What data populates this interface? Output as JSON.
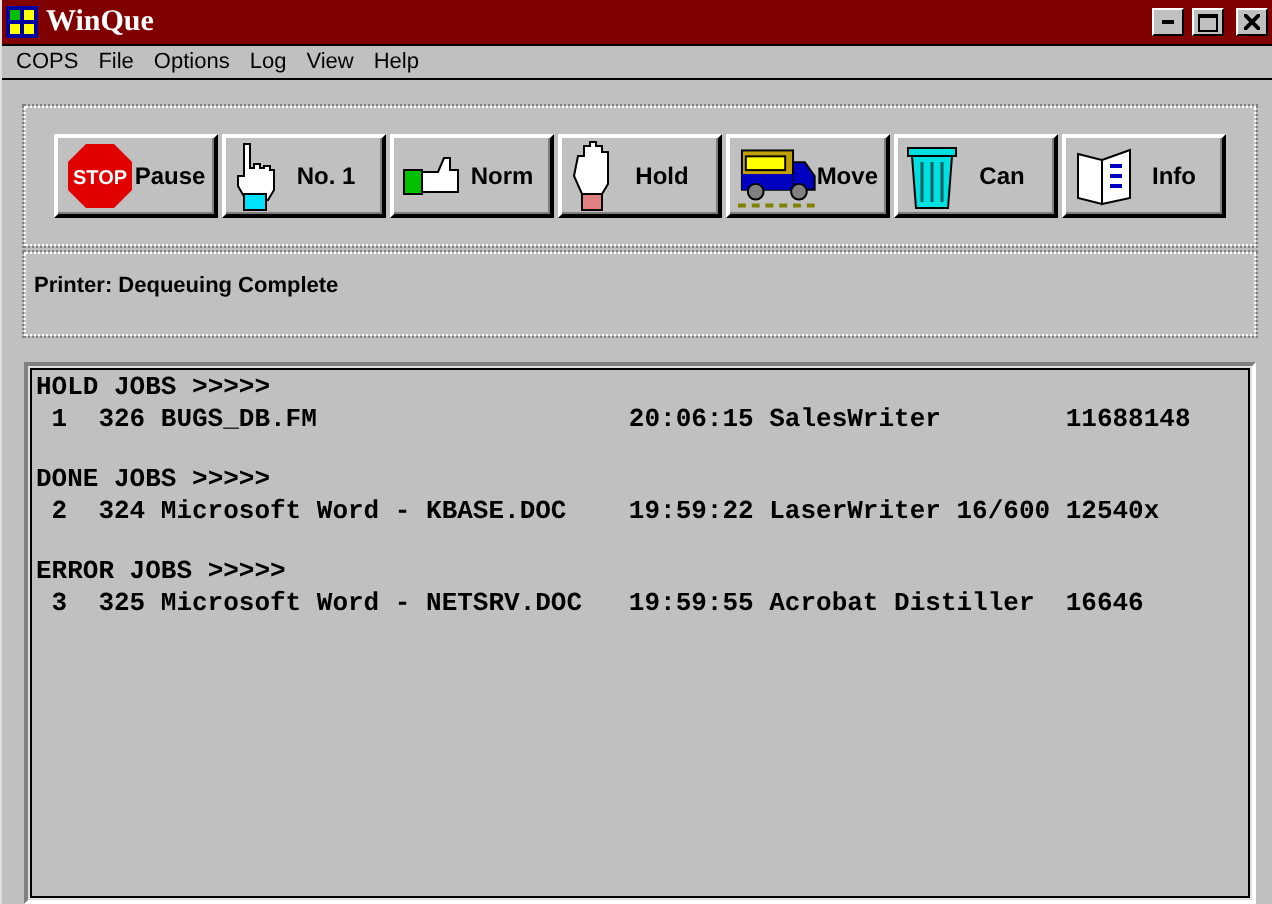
{
  "window": {
    "title": "WinQue"
  },
  "menu": [
    "COPS",
    "File",
    "Options",
    "Log",
    "View",
    "Help"
  ],
  "toolbar": [
    {
      "kind": "stop",
      "label": "Pause",
      "icon_text": "STOP"
    },
    {
      "kind": "pointing",
      "label": "No. 1"
    },
    {
      "kind": "thumb",
      "label": "Norm"
    },
    {
      "kind": "hand",
      "label": "Hold"
    },
    {
      "kind": "van",
      "label": "Move"
    },
    {
      "kind": "trash",
      "label": "Can"
    },
    {
      "kind": "book",
      "label": "Info"
    }
  ],
  "status": "Printer: Dequeuing Complete",
  "queues": [
    {
      "heading": "HOLD JOBS >>>>>",
      "jobs": [
        {
          "index": "1",
          "id": "326",
          "name": "BUGS_DB.FM",
          "time": "20:06:15",
          "printer": "SalesWriter",
          "size": "11688148"
        }
      ]
    },
    {
      "heading": "DONE JOBS >>>>>",
      "jobs": [
        {
          "index": "2",
          "id": "324",
          "name": "Microsoft Word - KBASE.DOC",
          "time": "19:59:22",
          "printer": "LaserWriter 16/600",
          "size": "12540x"
        }
      ]
    },
    {
      "heading": "ERROR JOBS >>>>>",
      "jobs": [
        {
          "index": "3",
          "id": "325",
          "name": "Microsoft Word - NETSRV.DOC",
          "time": "19:59:55",
          "printer": "Acrobat Distiller",
          "size": "16646"
        }
      ]
    }
  ]
}
